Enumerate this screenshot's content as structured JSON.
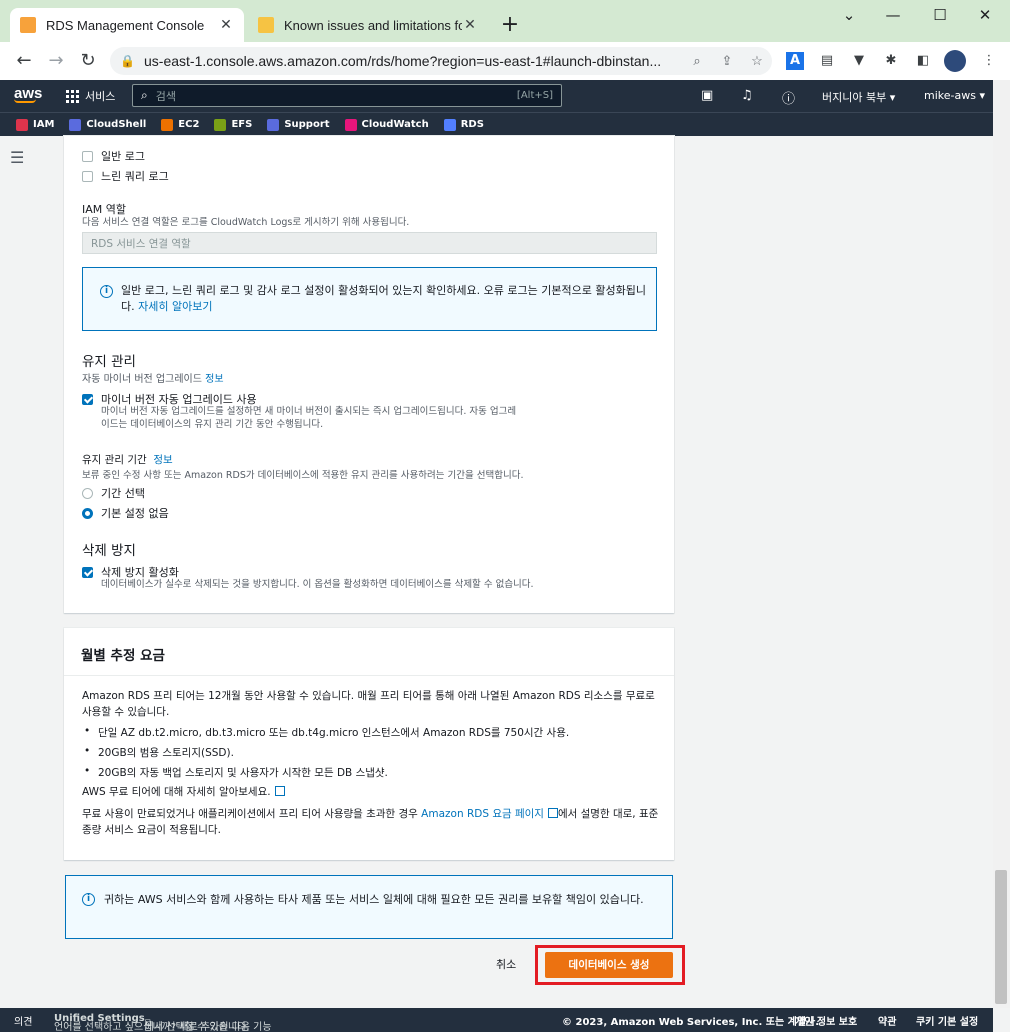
{
  "browser": {
    "tabs": [
      {
        "title": "RDS Management Console",
        "active": true
      },
      {
        "title": "Known issues and limitations fo",
        "active": false
      }
    ],
    "new_tab": "+",
    "window_controls": {
      "chevron": "⌄",
      "minimize": "—",
      "maximize": "☐",
      "close": "✕"
    },
    "url": "us-east-1.console.aws.amazon.com/rds/home?region=us-east-1#launch-dbinstan..."
  },
  "aws_nav": {
    "logo": "aws",
    "services_label": "서비스",
    "search_placeholder": "검색",
    "search_shortcut": "[Alt+S]",
    "region": "버지니아 북부 ▾",
    "account": "mike-aws ▾"
  },
  "favorites": [
    {
      "label": "IAM",
      "color": "#dd344c"
    },
    {
      "label": "CloudShell",
      "color": "#5a6bde"
    },
    {
      "label": "EC2",
      "color": "#ed7100"
    },
    {
      "label": "EFS",
      "color": "#7aa116"
    },
    {
      "label": "Support",
      "color": "#5a6bde"
    },
    {
      "label": "CloudWatch",
      "color": "#e7157b"
    },
    {
      "label": "RDS",
      "color": "#527fff"
    }
  ],
  "log_exports": {
    "general_log": "일반 로그",
    "slow_query_log": "느린 쿼리 로그"
  },
  "iam_role": {
    "title": "IAM 역할",
    "description": "다음 서비스 연결 역할은 로그를 CloudWatch Logs로 게시하기 위해 사용됩니다.",
    "placeholder": "RDS 서비스 연결 역할"
  },
  "log_info": {
    "text": "일반 로그, 느린 쿼리 로그 및 감사 로그 설정이 활성화되어 있는지 확인하세요. 오류 로그는 기본적으로 활성화됩니다.",
    "link": "자세히 알아보기"
  },
  "maintenance": {
    "title": "유지 관리",
    "auto_upgrade_label": "자동 마이너 버전 업그레이드",
    "info_link": "정보",
    "auto_upgrade_checkbox": "마이너 버전 자동 업그레이드 사용",
    "auto_upgrade_desc": "마이너 버전 자동 업그레이드를 설정하면 새 마이너 버전이 출시되는 즉시 업그레이드됩니다. 자동 업그레이드는 데이터베이스의 유지 관리 기간 동안 수행됩니다.",
    "window_title": "유지 관리 기간",
    "window_info": "정보",
    "window_desc": "보류 중인 수정 사항 또는 Amazon RDS가 데이터베이스에 적용한 유지 관리를 사용하려는 기간을 선택합니다.",
    "option_select": "기간 선택",
    "option_none": "기본 설정 없음",
    "selected": "option_none"
  },
  "deletion_protection": {
    "title": "삭제 방지",
    "checkbox": "삭제 방지 활성화",
    "desc": "데이터베이스가 실수로 삭제되는 것을 방지합니다. 이 옵션을 활성화하면 데이터베이스를 삭제할 수 없습니다.",
    "checked": true
  },
  "cost": {
    "title": "월별 추정 요금",
    "intro": "Amazon RDS 프리 티어는 12개월 동안 사용할 수 있습니다. 매월 프리 티어를 통해 아래 나열된 Amazon RDS 리소스를 무료로 사용할 수 있습니다.",
    "bullets": [
      "단일 AZ db.t2.micro, db.t3.micro 또는 db.t4g.micro 인스턴스에서 Amazon RDS를 750시간 사용.",
      "20GB의 범용 스토리지(SSD).",
      "20GB의 자동 백업 스토리지 및 사용자가 시작한 모든 DB 스냅샷."
    ],
    "free_tier_link": "AWS 무료 티어에 대해 자세히 알아보세요.",
    "after_prefix": "무료 사용이 만료되었거나 애플리케이션에서 프리 티어 사용량을 초과한 경우 ",
    "pricing_link": "Amazon RDS 요금 페이지",
    "after_suffix": "에서 설명한 대로, 표준 종량 서비스 요금이 적용됩니다."
  },
  "rights_info": "귀하는 AWS 서비스와 함께 사용하는 타사 제품 또는 서비스 일체에 대해 필요한 모든 권리를 보유할 책임이 있습니다.",
  "actions": {
    "cancel": "취소",
    "create": "데이터베이스 생성"
  },
  "footer": {
    "feedback": "의견",
    "language_prefix": "언어를 선택하고 싶으십니까? 새로 추가된 다음 기능",
    "unified": "Unified Settings",
    "language_suffix": "에서 선택할 수 있습니다.",
    "copyright": "© 2023, Amazon Web Services, Inc. 또는 계열사.",
    "privacy": "개인 정보 보호",
    "terms": "약관",
    "cookies": "쿠키 기본 설정"
  }
}
